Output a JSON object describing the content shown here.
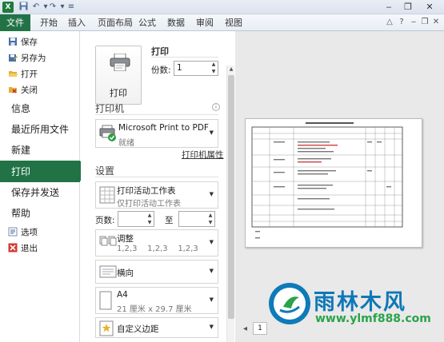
{
  "titlebar": {
    "app_icon": "X",
    "qat_icons": [
      "save-icon",
      "undo-icon",
      "redo-icon",
      "customize-icon"
    ],
    "window_buttons": [
      "minimize-icon",
      "restore-icon",
      "close-icon"
    ]
  },
  "ribbon": {
    "file_tab": "文件",
    "tabs": [
      "开始",
      "插入",
      "页面布局",
      "公式",
      "数据",
      "审阅",
      "视图"
    ]
  },
  "nav": {
    "save": "保存",
    "save_as": "另存为",
    "open": "打开",
    "close": "关闭",
    "info": "信息",
    "recent": "最近所用文件",
    "new": "新建",
    "print": "打印",
    "save_send": "保存并发送",
    "help": "帮助",
    "options": "选项",
    "exit": "退出"
  },
  "print_panel": {
    "title": "打印",
    "print_button": "打印",
    "copies_label": "份数:",
    "copies_value": "1",
    "printer_heading": "打印机",
    "printer_name": "Microsoft Print to PDF",
    "printer_status": "就绪",
    "printer_props_link": "打印机属性",
    "settings_heading": "设置",
    "scope_main": "打印活动工作表",
    "scope_sub": "仅打印活动工作表",
    "pages_label": "页数:",
    "to_label": "至",
    "collate_main": "调整",
    "collate_sub": "1,2,3    1,2,3    1,2,3",
    "orientation": "横向",
    "paper_main": "A4",
    "paper_sub": "21 厘米 x 29.7 厘米",
    "margins": "自定义边距"
  },
  "preview": {
    "page_value": "1"
  },
  "watermark": {
    "brand": "雨林木风",
    "url": "www.ylmf888.com"
  },
  "colors": {
    "accent": "#217346",
    "watermark_blue": "#0f78b8",
    "watermark_green": "#2aa34a"
  }
}
